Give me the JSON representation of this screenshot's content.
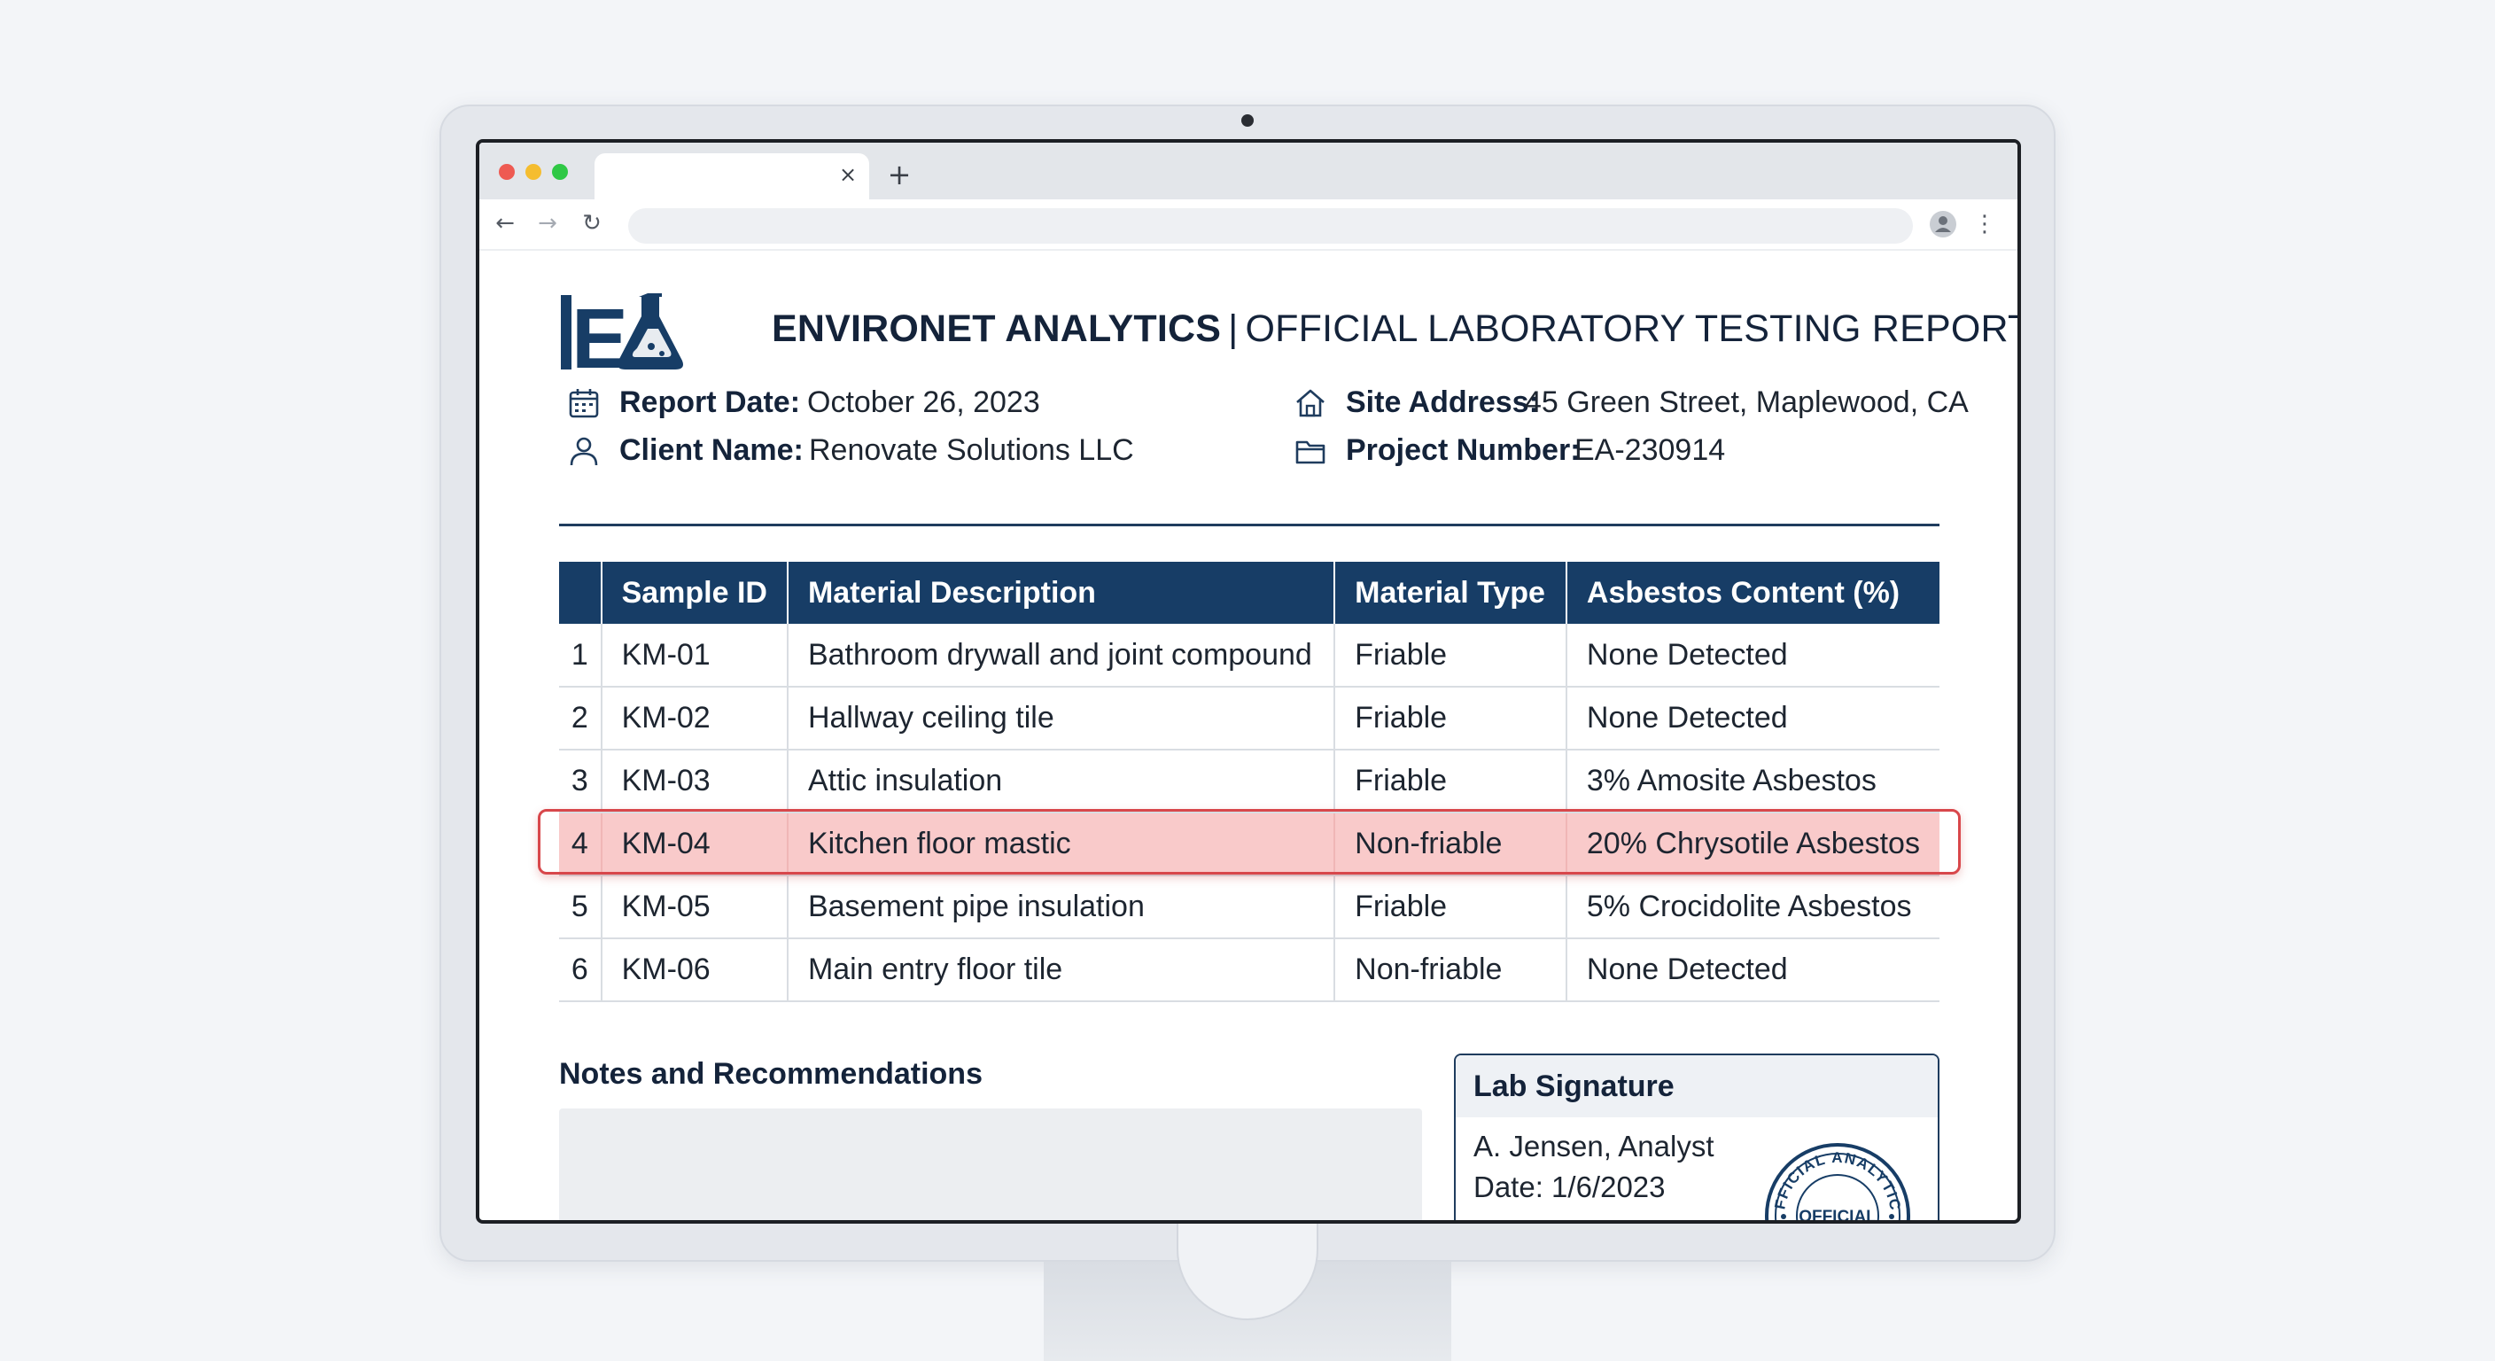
{
  "browser": {
    "tab_close_glyph": "×",
    "new_tab_glyph": "+",
    "address_value": ""
  },
  "report": {
    "company": "ENVIRONET ANALYTICS",
    "separator": "|",
    "title": "OFFICIAL LABORATORY TESTING REPORT",
    "logo_text": "EA",
    "meta": {
      "report_date_label": "Report Date:",
      "report_date_value": "October 26, 2023",
      "client_name_label": "Client Name:",
      "client_name_value": "Renovate Solutions LLC",
      "site_address_label": "Site Address:",
      "site_address_value": "45 Green Street, Maplewood, CA",
      "project_number_label": "Project Number:",
      "project_number_value": "EA-230914"
    },
    "table": {
      "headers": [
        "",
        "Sample ID",
        "Material Description",
        "Material Type",
        "Asbestos Content (%)"
      ],
      "rows": [
        {
          "num": "1",
          "id": "KM-01",
          "desc": "Bathroom drywall and joint compound",
          "type": "Friable",
          "content": "None Detected"
        },
        {
          "num": "2",
          "id": "KM-02",
          "desc": "Hallway ceiling tile",
          "type": "Friable",
          "content": "None Detected"
        },
        {
          "num": "3",
          "id": "KM-03",
          "desc": "Attic insulation",
          "type": "Friable",
          "content": "3% Amosite Asbestos"
        },
        {
          "num": "4",
          "id": "KM-04",
          "desc": "Kitchen floor mastic",
          "type": "Non-friable",
          "content": "20% Chrysotile Asbestos"
        },
        {
          "num": "5",
          "id": "KM-05",
          "desc": "Basement pipe insulation",
          "type": "Friable",
          "content": "5% Crocidolite Asbestos"
        },
        {
          "num": "6",
          "id": "KM-06",
          "desc": "Main entry floor tile",
          "type": "Non-friable",
          "content": "None Detected"
        }
      ],
      "highlighted_row": 4
    },
    "notes": {
      "heading": "Notes and Recommendations",
      "body": ""
    },
    "signature": {
      "heading": "Lab Signature",
      "name": "A. Jensen, Analyst",
      "date": "Date: 1/6/2023",
      "stamp_text_arc": "OFFICIAL ANALYTICS",
      "stamp_text_band": "OFFICIAL"
    }
  },
  "colors": {
    "brand_navy": "#173d66",
    "highlight_fill": "#f9caca",
    "highlight_border": "#d8474b"
  },
  "icons": {
    "report_date": "calendar-icon",
    "client_name": "user-icon",
    "site_address": "home-icon",
    "project_number": "folder-icon"
  }
}
